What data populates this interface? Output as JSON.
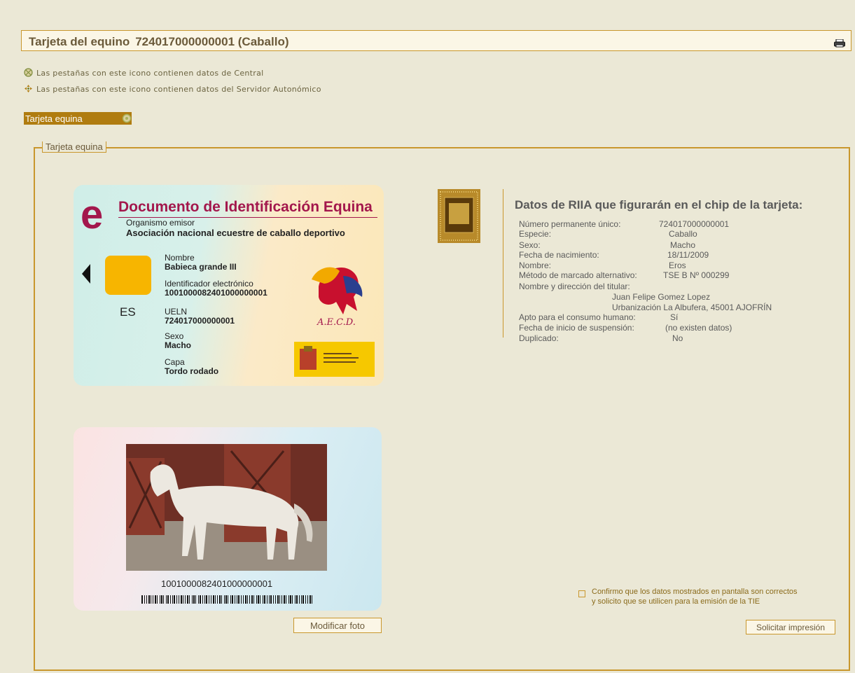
{
  "header": {
    "title_prefix": "Tarjeta del equino",
    "title_number": "724017000000001 (Caballo)",
    "print_icon": "printer-icon"
  },
  "legend": {
    "central": "Las pestañas con este icono contienen datos de Central",
    "autonomo": "Las pestañas con este icono contienen datos del Servidor Autonómico",
    "central_icon": "globe-icon",
    "autonomo_icon": "move-arrows-icon"
  },
  "tab": {
    "label": "Tarjeta equina",
    "icon": "globe-icon"
  },
  "fieldset_legend": "Tarjeta equina",
  "card_front": {
    "title": "Documento de Identificación Equina",
    "org_label": "Organismo emisor",
    "org_value": "Asociación nacional ecuestre de caballo deportivo",
    "country": "ES",
    "fields": [
      {
        "label": "Nombre",
        "value": "Babieca grande III"
      },
      {
        "label": "Identificador electrónico",
        "value": "1001000082401000000001"
      },
      {
        "label": "UELN",
        "value": "724017000000001"
      },
      {
        "label": "Sexo",
        "value": "Macho"
      },
      {
        "label": "Capa",
        "value": "Tordo rodado"
      }
    ],
    "logo_text": "A.E.C.D."
  },
  "card_back": {
    "barcode_number": "1001000082401000000001"
  },
  "buttons": {
    "modify_photo": "Modificar foto",
    "request_print": "Solicitar impresión"
  },
  "details": {
    "title": "Datos de RIIA que figurarán en el chip de la tarjeta:",
    "rows": [
      {
        "label": "Número permanente único:",
        "value": "724017000000001"
      },
      {
        "label": "Especie:",
        "value": "Caballo"
      },
      {
        "label": "Sexo:",
        "value": "Macho"
      },
      {
        "label": "Fecha de nacimiento:",
        "value": "18/11/2009"
      },
      {
        "label": "Nombre:",
        "value": "Eros"
      },
      {
        "label": "Método de marcado alternativo:",
        "value": "TSE B Nº 000299"
      },
      {
        "label": "Nombre y dirección del titular:",
        "value": ""
      },
      {
        "label": "",
        "value": "Juan Felipe Gomez Lopez"
      },
      {
        "label": "",
        "value": "Urbanización La Albufera, 45001 AJOFRÍN"
      },
      {
        "label": "Apto para el consumo humano:",
        "value": "Sí"
      },
      {
        "label": "Fecha de inicio de  suspensión:",
        "value": "(no existen datos)"
      },
      {
        "label": "Duplicado:",
        "value": "No"
      }
    ]
  },
  "confirm": {
    "line1": "Confirmo que los datos mostrados en pantalla son correctos",
    "line2": "y solicito que se utilicen para la emisión de la TIE",
    "checked": false
  },
  "colors": {
    "background": "#ebe8d6",
    "accent": "#c9972d",
    "tab": "#b07c10",
    "card_title": "#a3174c"
  }
}
